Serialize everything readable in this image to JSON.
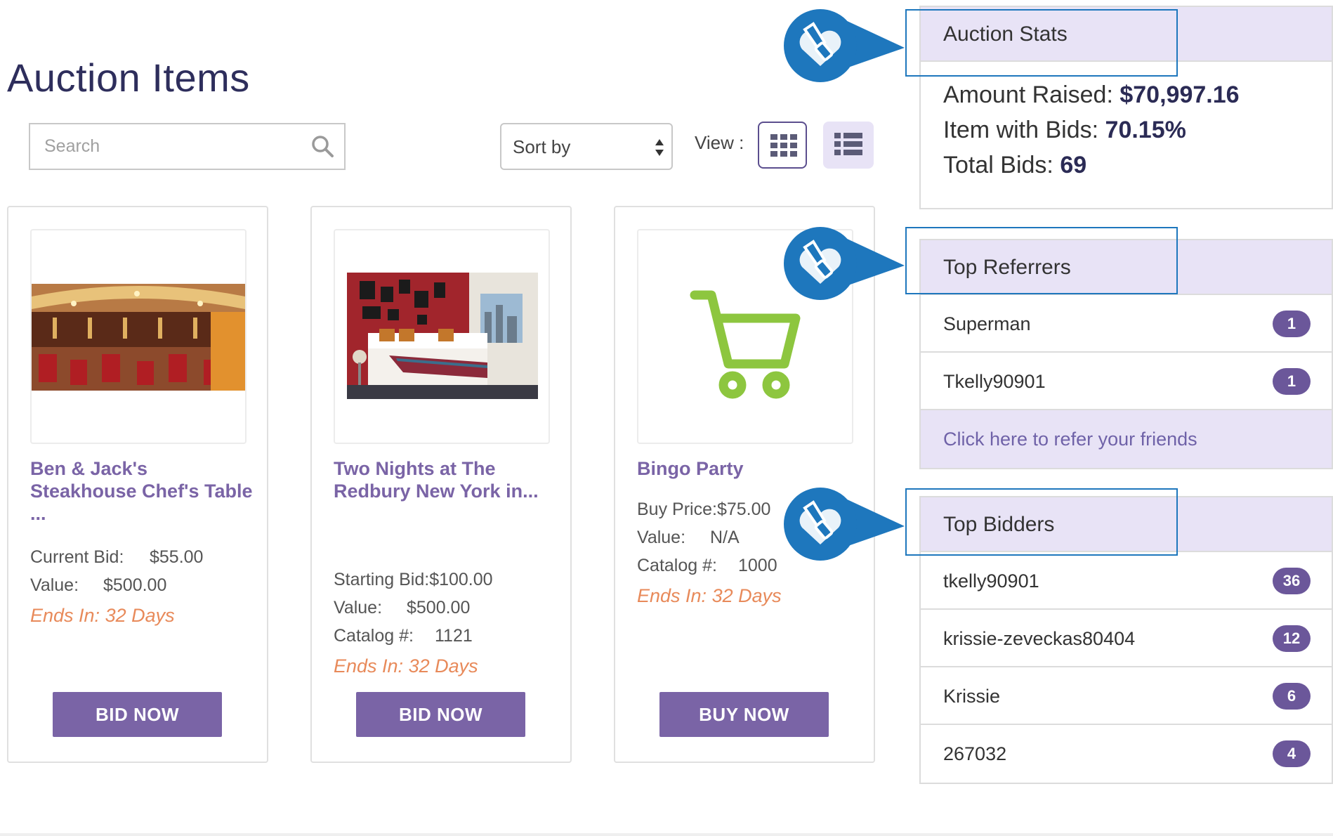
{
  "page": {
    "title": "Auction Items"
  },
  "toolbar": {
    "search_placeholder": "Search",
    "sort_label": "Sort by",
    "view_label": "View :"
  },
  "items": [
    {
      "title": "Ben & Jack's Steakhouse Chef's Table ...",
      "rows": [
        {
          "label": "Current Bid:",
          "value": "$55.00"
        },
        {
          "label": "Value:",
          "value": "$500.00"
        }
      ],
      "ends": "Ends In: 32 Days",
      "button": "BID NOW"
    },
    {
      "title": "Two Nights at The Redbury New York in...",
      "rows": [
        {
          "label": "Starting Bid:",
          "value": "$100.00"
        },
        {
          "label": "Value:",
          "value": "$500.00"
        },
        {
          "label": "Catalog #:",
          "value": "1121"
        }
      ],
      "ends": "Ends In: 32 Days",
      "button": "BID NOW"
    },
    {
      "title": "Bingo Party",
      "rows": [
        {
          "label": "Buy Price:",
          "value": "$75.00"
        },
        {
          "label": "Value:",
          "value": "N/A"
        },
        {
          "label": "Catalog #:",
          "value": "1000"
        }
      ],
      "ends": "Ends In: 32 Days",
      "button": "BUY NOW"
    }
  ],
  "stats": {
    "header": "Auction Stats",
    "amount_label": "Amount Raised:",
    "amount_value": "$70,997.16",
    "bids_pct_label": "Item with Bids:",
    "bids_pct_value": "70.15%",
    "total_label": "Total Bids:",
    "total_value": "69"
  },
  "referrers": {
    "header": "Top Referrers",
    "rows": [
      {
        "name": "Superman",
        "count": "1"
      },
      {
        "name": "Tkelly90901",
        "count": "1"
      }
    ],
    "refer_link": "Click here to refer your friends"
  },
  "bidders": {
    "header": "Top Bidders",
    "rows": [
      {
        "name": "tkelly90901",
        "count": "36"
      },
      {
        "name": "krissie-zeveckas80404",
        "count": "12"
      },
      {
        "name": "Krissie",
        "count": "6"
      },
      {
        "name": "267032",
        "count": "4"
      }
    ]
  },
  "colors": {
    "accent": "#7a64a6",
    "title": "#2e2e5c",
    "ends": "#e88a5a",
    "panel_header": "#e8e3f6",
    "callout": "#1e77bd",
    "cart": "#8dc63f"
  },
  "icons": [
    "search-icon",
    "sort-arrows-icon",
    "grid-view-icon",
    "list-view-icon",
    "cart-icon",
    "heart-hand-callout-icon"
  ]
}
